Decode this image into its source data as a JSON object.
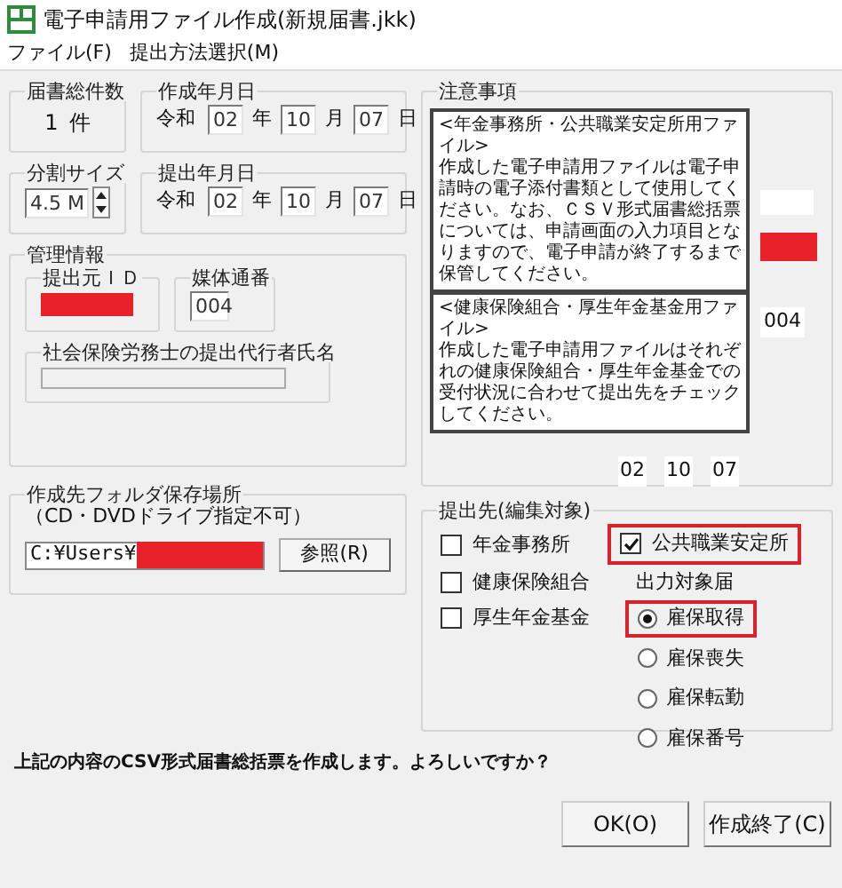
{
  "window": {
    "title": "電子申請用ファイル作成(新規届書.jkk)"
  },
  "menu": [
    {
      "label": "ファイル(F)"
    },
    {
      "label": "提出方法選択(M)"
    }
  ],
  "total_count": {
    "label": "届書総件数",
    "value": "1",
    "unit": "件"
  },
  "creation_date": {
    "label": "作成年月日",
    "era": "令和",
    "year": "02",
    "year_unit": "年",
    "month": "10",
    "month_unit": "月",
    "day": "07",
    "day_unit": "日"
  },
  "split_size": {
    "label": "分割サイズ",
    "value": "4.5 M"
  },
  "submission_date": {
    "label": "提出年月日",
    "era": "令和",
    "year": "02",
    "year_unit": "年",
    "month": "10",
    "month_unit": "月",
    "day": "07",
    "day_unit": "日"
  },
  "management": {
    "label": "管理情報",
    "submitter_id": {
      "label": "提出元ＩＤ",
      "redacted": true
    },
    "media_number": {
      "label": "媒体通番",
      "value": "004"
    },
    "agent_name": {
      "label": "社会保険労務士の提出代行者氏名"
    }
  },
  "notice": {
    "label": "注意事項",
    "popup": [
      {
        "heading": "<年金事務所・公共職業安定所用ファイル>",
        "body": "作成した電子申請用ファイルは電子申請時の電子添付書類として使用してください。なお、ＣＳＶ形式届書総括票については、申請画面の入力項目となりますので、電子申請が終了するまで保管してください。"
      },
      {
        "heading": "<健康保険組合・厚生年金基金用ファイル>",
        "body": "作成した電子申請用ファイルはそれぞれの健康保険組合・厚生年金基金での受付状況に合わせて提出先をチェックしてください。"
      }
    ],
    "behind": {
      "redacted": true,
      "media_number": "004",
      "date": [
        "02",
        "10",
        "07"
      ]
    }
  },
  "folder": {
    "label": "作成先フォルダ保存場所",
    "note": "（CD・DVDドライブ指定不可）",
    "value": "C:¥Users¥",
    "redacted": true,
    "browse_button": "参照(R)"
  },
  "destinations": {
    "label": "提出先(編集対象)",
    "checkboxes": [
      {
        "label": "年金事務所",
        "checked": false
      },
      {
        "label": "健康保険組合",
        "checked": false
      },
      {
        "label": "厚生年金基金",
        "checked": false
      }
    ],
    "hello_work": {
      "label": "公共職業安定所",
      "checked": true,
      "highlighted": true
    },
    "output_label": "出力対象届",
    "radios": [
      {
        "label": "雇保取得",
        "selected": true,
        "highlighted": true
      },
      {
        "label": "雇保喪失",
        "selected": false,
        "highlighted": false
      },
      {
        "label": "雇保転勤",
        "selected": false,
        "highlighted": false
      },
      {
        "label": "雇保番号",
        "selected": false,
        "highlighted": false
      }
    ]
  },
  "message": "上記の内容のCSV形式届書総括票を作成します。よろしいですか？",
  "buttons": [
    {
      "label": "OK(O)"
    },
    {
      "label": "作成終了(C)"
    }
  ]
}
